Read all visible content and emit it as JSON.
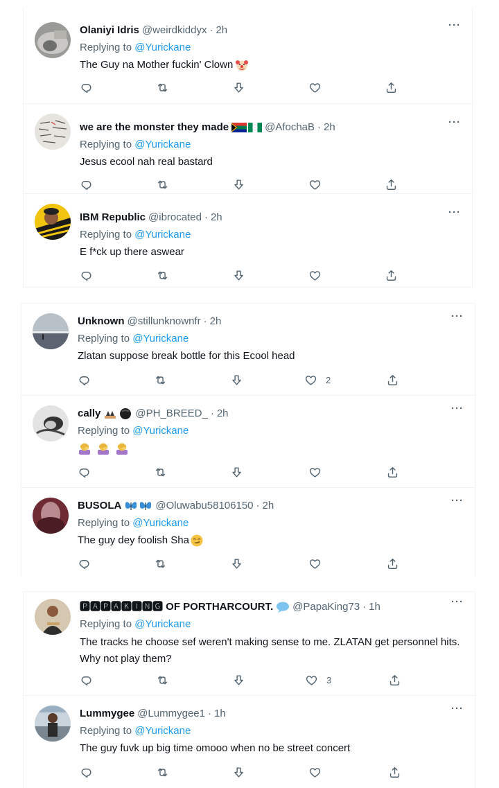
{
  "tweets": [
    {
      "name": "Olaniyi Idris",
      "handle": "@weirdkiddyx",
      "time": "2h",
      "reply_prefix": "Replying to",
      "mention": "@Yurickane",
      "text": "The Guy na Mother fuckin' Clown",
      "like_count": "",
      "more": "···"
    },
    {
      "name": "we are the monster they made",
      "handle": "@AfochaB",
      "time": "2h",
      "reply_prefix": "Replying to",
      "mention": "@Yurickane",
      "text": "Jesus ecool nah real bastard",
      "like_count": "",
      "more": "···"
    },
    {
      "name": "IBM Republic",
      "handle": "@ibrocated",
      "time": "2h",
      "reply_prefix": "Replying to",
      "mention": "@Yurickane",
      "text": "E f*ck up there aswear",
      "like_count": "",
      "more": "···"
    },
    {
      "name": "Unknown",
      "handle": "@stillunknownfr",
      "time": "2h",
      "reply_prefix": "Replying to",
      "mention": "@Yurickane",
      "text": "Zlatan suppose break bottle for this Ecool head",
      "like_count": "2",
      "more": "···"
    },
    {
      "name": "cally",
      "handle": "@PH_BREED_",
      "time": "2h",
      "reply_prefix": "Replying to",
      "mention": "@Yurickane",
      "text": "",
      "like_count": "",
      "more": "···"
    },
    {
      "name": "BUSOLA",
      "handle": "@Oluwabu58106150",
      "time": "2h",
      "reply_prefix": "Replying to",
      "mention": "@Yurickane",
      "text": "The guy dey foolish Sha",
      "like_count": "",
      "more": "···"
    },
    {
      "name": "🅿🅰🅿🅰🅺🅸🅽🅶 OF PORTHARCOURT.",
      "handle": "@PapaKing73",
      "time": "1h",
      "reply_prefix": "Replying to",
      "mention": "@Yurickane",
      "text": "The tracks he choose sef weren't making sense to me. ZLATAN get personnel hits. Why not play them?",
      "like_count": "3",
      "more": "···"
    },
    {
      "name": "Lummygee",
      "handle": "@Lummygee1",
      "time": "1h",
      "reply_prefix": "Replying to",
      "mention": "@Yurickane",
      "text": "The guy fuvk up big time omooo when no be street concert",
      "like_count": "",
      "more": "···"
    }
  ],
  "dot": "·",
  "colors": {
    "accent": "#1d9bf0",
    "muted": "#536471",
    "text": "#0f1419",
    "border": "#eff3f4"
  },
  "icons": [
    "reply-icon",
    "retweet-icon",
    "downvote-icon",
    "like-icon",
    "share-icon",
    "more-icon"
  ]
}
